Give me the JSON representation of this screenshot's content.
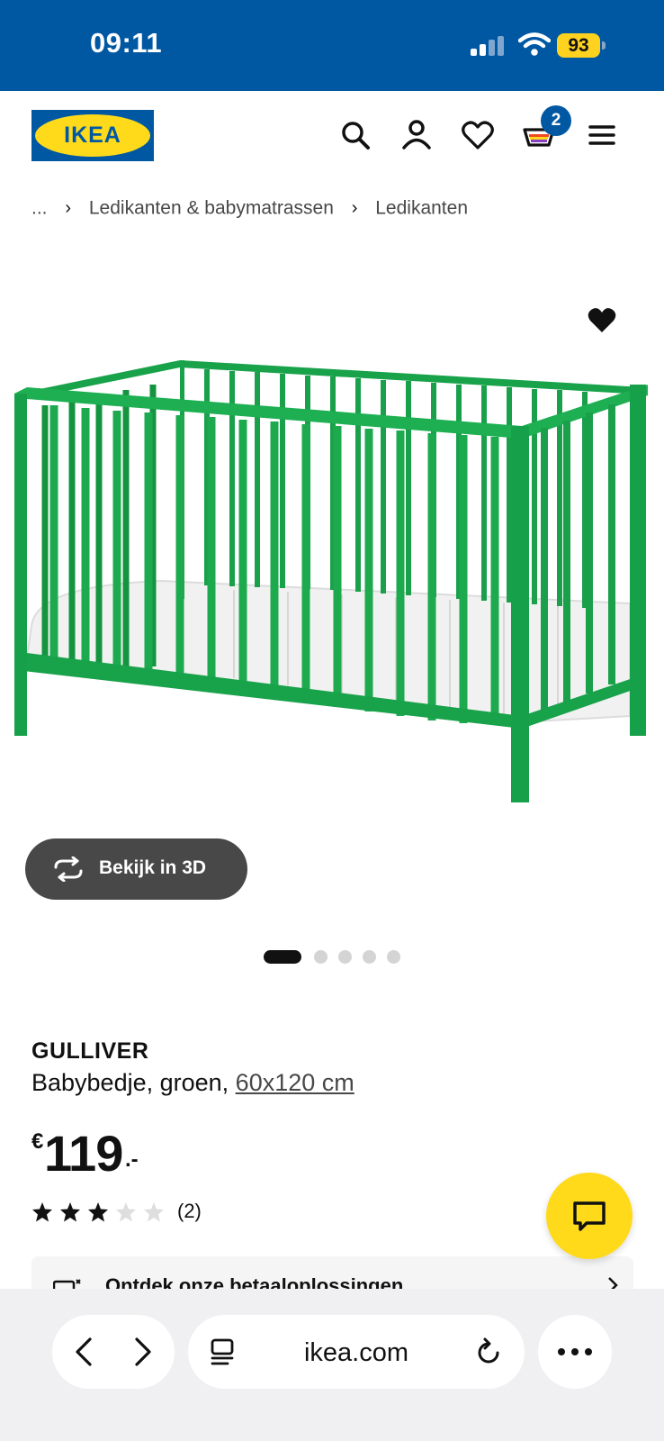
{
  "status_bar": {
    "time": "09:11",
    "battery": "93"
  },
  "header": {
    "logo_text": "IKEA",
    "cart_count": "2",
    "icons": [
      "search-icon",
      "account-icon",
      "heart-icon",
      "cart-icon",
      "menu-icon"
    ]
  },
  "breadcrumb": {
    "ellipsis": "...",
    "items": [
      "Ledikanten & babymatrassen",
      "Ledikanten"
    ]
  },
  "gallery": {
    "view_3d_label": "Bekijk in 3D",
    "slide_count": 5,
    "active_slide": 1
  },
  "product": {
    "name": "GULLIVER",
    "description": "Babybedje, groen, ",
    "size": "60x120 cm",
    "price_currency": "€",
    "price_value": "119",
    "price_suffix": ".-",
    "rating": 3,
    "rating_max": 5,
    "review_count": "(2)"
  },
  "payment_banner": {
    "text": "Ontdek onze betaaloplossingen"
  },
  "browser": {
    "url": "ikea.com"
  },
  "colors": {
    "brand_blue": "#0058a3",
    "brand_yellow": "#ffda1a",
    "crib_green": "#18a24a"
  }
}
